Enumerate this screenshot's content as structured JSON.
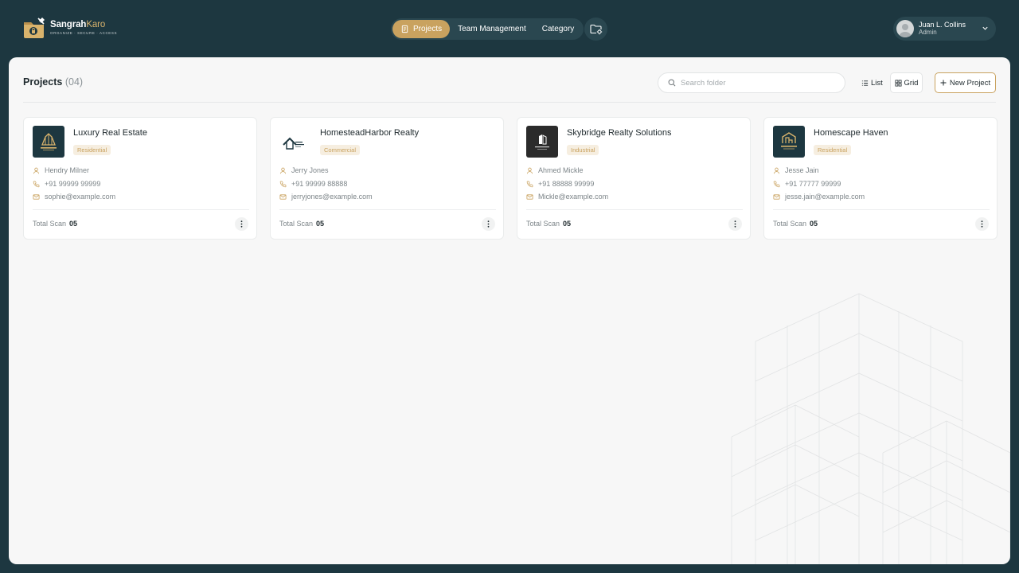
{
  "brand": {
    "name_bold": "Sangrah",
    "name_light": "Karo",
    "tagline": "ORGANIZE · SECURE · ACCESS"
  },
  "nav": {
    "items": [
      {
        "label": "Projects",
        "active": true
      },
      {
        "label": "Team Management",
        "active": false
      },
      {
        "label": "Category",
        "active": false
      }
    ]
  },
  "user": {
    "name": "Juan L. Collins",
    "role": "Admin"
  },
  "page": {
    "title": "Projects",
    "count": "(04)"
  },
  "toolbar": {
    "search_placeholder": "Search folder",
    "list_label": "List",
    "grid_label": "Grid",
    "new_project_label": "New Project"
  },
  "colors": {
    "background": "#1d3740",
    "accent": "#c9a25f",
    "panel": "#f7f7f7"
  },
  "projects": [
    {
      "title": "Luxury Real Estate",
      "badge": "Residential",
      "person": "Hendry Milner",
      "phone": "+91 99999 99999",
      "email": "sophie@example.com",
      "scan_label": "Total Scan",
      "scan_value": "05",
      "logo": "building-gold-icon"
    },
    {
      "title": "HomesteadHarbor Realty",
      "badge": "Commercial",
      "person": "Jerry Jones",
      "phone": "+91 99999 88888",
      "email": "jerryjones@example.com",
      "scan_label": "Total Scan",
      "scan_value": "05",
      "logo": "house-roof-icon"
    },
    {
      "title": "Skybridge Realty Solutions",
      "badge": "Industrial",
      "person": "Ahmed Mickle",
      "phone": "+91 88888 99999",
      "email": "Mickle@example.com",
      "scan_label": "Total Scan",
      "scan_value": "05",
      "logo": "tower-white-icon"
    },
    {
      "title": "Homescape Haven",
      "badge": "Residential",
      "person": "Jesse Jain",
      "phone": "+91 77777 99999",
      "email": "jesse.jain@example.com",
      "scan_label": "Total Scan",
      "scan_value": "05",
      "logo": "house-gold-icon"
    }
  ]
}
